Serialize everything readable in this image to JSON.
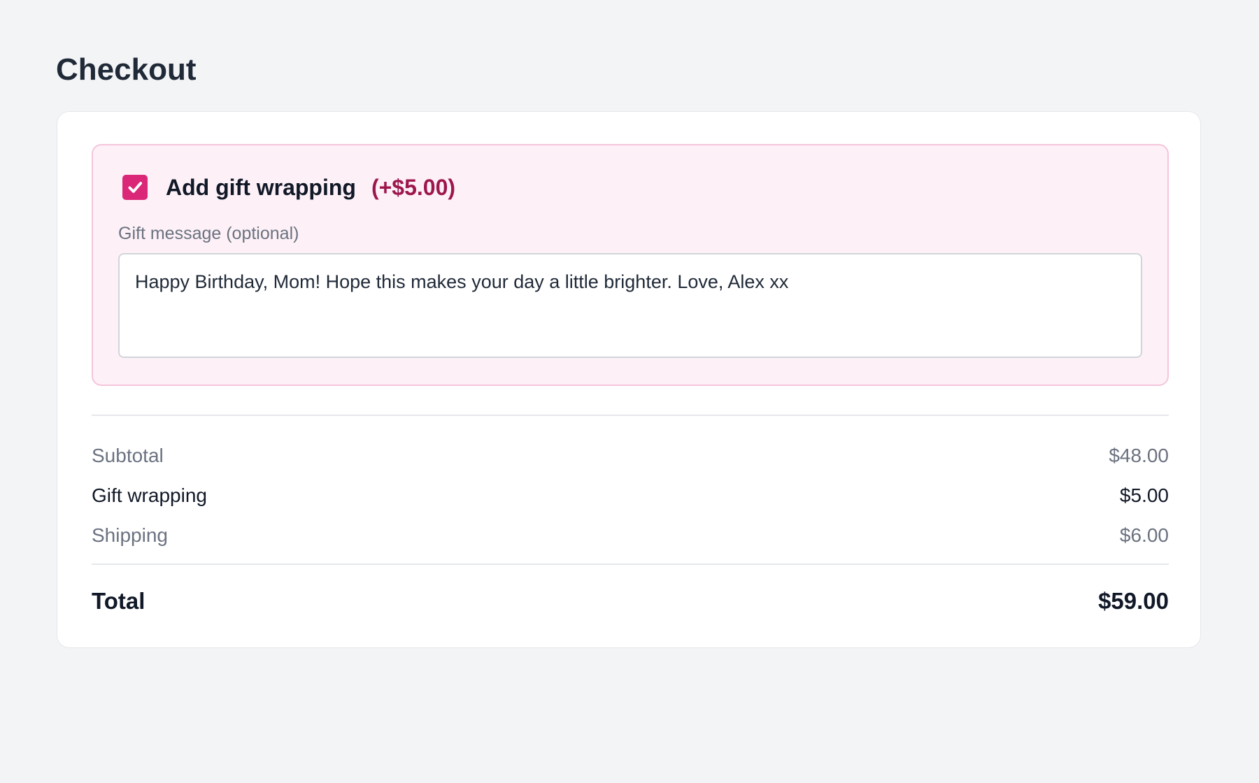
{
  "page": {
    "title": "Checkout"
  },
  "gift_wrap": {
    "checked": true,
    "label": "Add gift wrapping",
    "price_text": "(+$5.00)",
    "message_label": "Gift message (optional)",
    "message_value": "Happy Birthday, Mom! Hope this makes your day a little brighter. Love, Alex xx"
  },
  "summary": {
    "subtotal": {
      "label": "Subtotal",
      "value": "$48.00"
    },
    "gift_wrapping": {
      "label": "Gift wrapping",
      "value": "$5.00"
    },
    "shipping": {
      "label": "Shipping",
      "value": "$6.00"
    },
    "total": {
      "label": "Total",
      "value": "$59.00"
    }
  },
  "colors": {
    "accent": "#db2777",
    "price_accent": "#9d174d",
    "gift_box_bg": "#fdf1f7",
    "gift_box_border": "#f5c5db",
    "page_bg": "#f3f4f6"
  },
  "icons": {
    "checkbox": "checkmark-icon"
  }
}
